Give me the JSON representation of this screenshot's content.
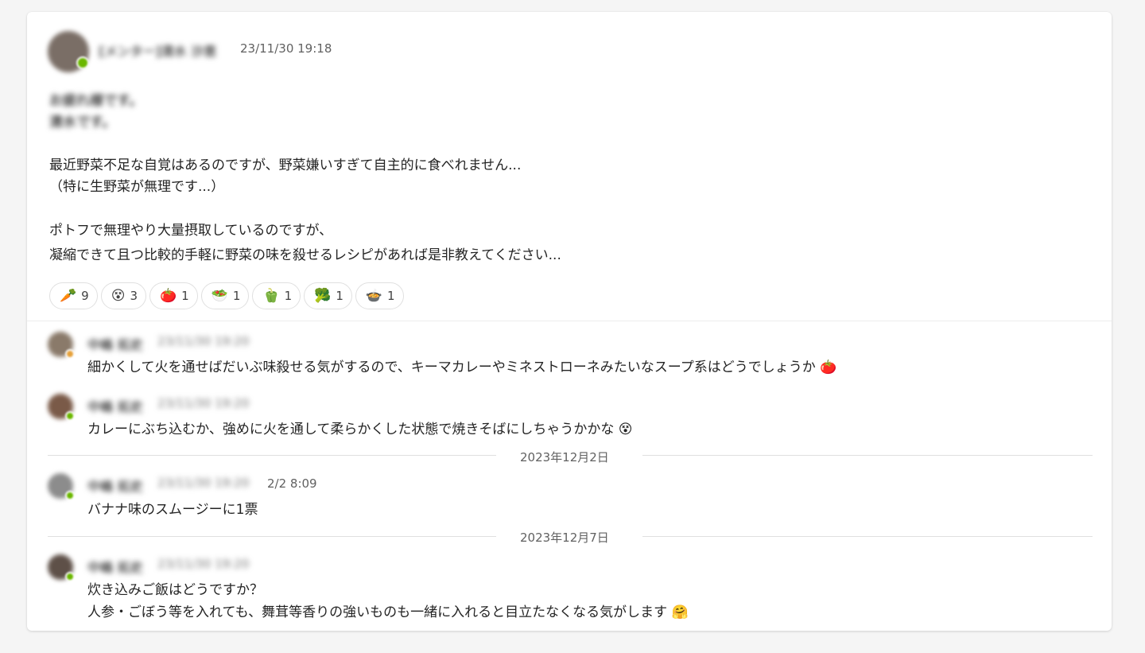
{
  "post": {
    "author": "[メンター]清水 沙恵",
    "timestamp": "23/11/30 19:18",
    "greeting_lines": [
      "お疲れ様です。",
      "清水です。"
    ],
    "body_lines": [
      "最近野菜不足な自覚はあるのですが、野菜嫌いすぎて自主的に食べれません...",
      "（特に生野菜が無理です...）",
      "ポトフで無理やり大量摂取しているのですが、",
      "凝縮できて且つ比較的手軽に野菜の味を殺せるレシピがあれば是非教えてください..."
    ],
    "reactions": [
      {
        "emoji": "🥕",
        "count": "9"
      },
      {
        "emoji": "😵",
        "count": "3"
      },
      {
        "emoji": "🍅",
        "count": "1"
      },
      {
        "emoji": "🥗",
        "count": "1"
      },
      {
        "emoji": "🫑",
        "count": "1"
      },
      {
        "emoji": "🥦",
        "count": "1"
      },
      {
        "emoji": "🍲",
        "count": "1"
      }
    ]
  },
  "replies": [
    {
      "author": "中嶋 拓史",
      "time": "23/11/30 19:20",
      "text": "細かくして火を通せばだいぶ味殺せる気がするので、キーマカレーやミネストローネみたいなスープ系はどうでしょうか",
      "emoji": "🍅",
      "avatar_color": "#8a7a6a"
    },
    {
      "author": "中嶋 拓史",
      "time": "23/11/30 19:20",
      "text": "カレーにぶち込むか、強めに火を通して柔らかくした状態で焼きそばにしちゃうかかな",
      "emoji": "😵",
      "avatar_color": "#7a5a48"
    },
    {
      "author": "中嶋 拓史",
      "time": "23/11/30 19:20",
      "edited_time": "2/2 8:09",
      "text": "バナナ味のスムージーに1票",
      "emoji": "",
      "avatar_color": "#8c8c8c"
    },
    {
      "author": "中嶋 拓史",
      "time": "23/11/30 19:20",
      "text": "炊き込みご飯はどうですか？",
      "text2": "人参・ごぼう等を入れても、舞茸等香りの強いものも一緒に入れると目立たなくなる気がします",
      "emoji": "🤗",
      "avatar_color": "#5e5048"
    }
  ],
  "date_dividers": [
    "2023年12月2日",
    "2023年12月7日"
  ],
  "colors": {
    "presence": "#6bb700",
    "card_bg": "#ffffff",
    "page_bg": "#f5f5f5"
  }
}
